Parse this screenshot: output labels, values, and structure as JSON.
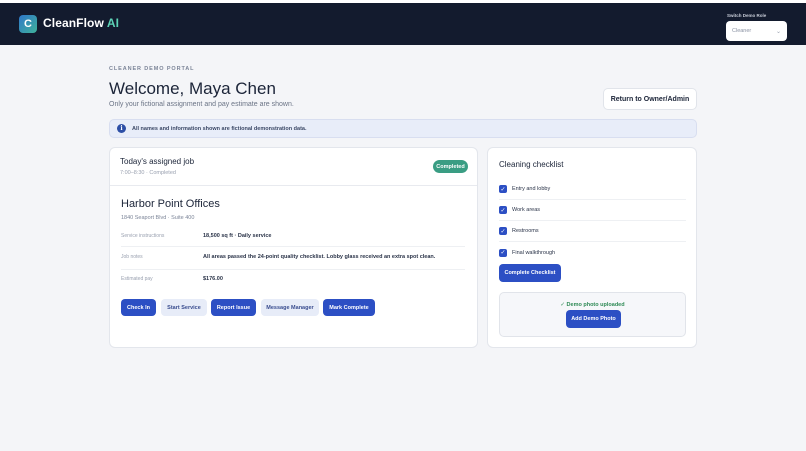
{
  "header": {
    "logo_letter": "C",
    "brand_main": "CleanFlow",
    "brand_accent": "AI",
    "role_label": "Switch Demo Role",
    "role_selected": "Cleaner"
  },
  "page": {
    "eyebrow": "CLEANER DEMO PORTAL",
    "welcome": "Welcome, Maya Chen",
    "subtitle": "Only your fictional assignment and pay estimate are shown.",
    "return_button": "Return to Owner/Admin"
  },
  "notice": {
    "icon": "i",
    "text": "All names and information shown are fictional demonstration data."
  },
  "job": {
    "title": "Today's assigned job",
    "time": "7:00–8:30 · Completed",
    "status": "Completed",
    "site_name": "Harbor Point Offices",
    "address": "1840 Seaport Blvd · Suite 400",
    "details": [
      {
        "label": "Service instructions",
        "value": "18,500 sq ft · Daily service"
      },
      {
        "label": "Job notes",
        "value": "All areas passed the 24-point quality checklist. Lobby glass received an extra spot clean."
      },
      {
        "label": "Estimated pay",
        "value": "$176.00"
      }
    ],
    "actions": [
      "Check In",
      "Start Service",
      "Report Issue",
      "Message Manager",
      "Mark Complete"
    ]
  },
  "checklist": {
    "title": "Cleaning checklist",
    "items": [
      {
        "label": "Entry and lobby",
        "checked": true
      },
      {
        "label": "Work areas",
        "checked": true
      },
      {
        "label": "Restrooms",
        "checked": true
      },
      {
        "label": "Final walkthrough",
        "checked": true
      }
    ],
    "complete_button": "Complete Checklist",
    "photo_status": "✓ Demo photo uploaded",
    "photo_button": "Add Demo Photo"
  },
  "colors": {
    "header_bg": "#131b2e",
    "primary": "#2c4fc4",
    "success_badge": "#3a9d83",
    "accent_text": "#5dd3b7"
  }
}
